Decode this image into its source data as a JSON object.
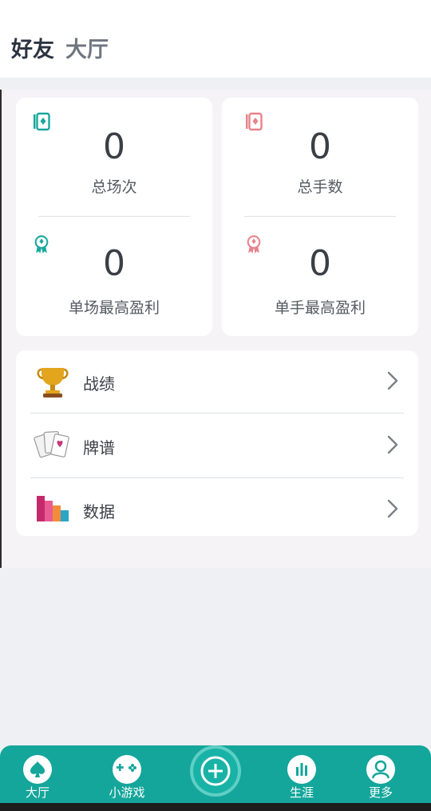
{
  "header": {
    "tab_friends": "好友",
    "tab_lobby": "大厅"
  },
  "stats": {
    "total_games_value": "0",
    "total_games_label": "总场次",
    "total_hands_value": "0",
    "total_hands_label": "总手数",
    "best_game_profit_value": "0",
    "best_game_profit_label": "单场最高盈利",
    "best_hand_profit_value": "0",
    "best_hand_profit_label": "单手最高盈利"
  },
  "menu": {
    "items": [
      {
        "label": "战绩",
        "icon": "trophy-icon"
      },
      {
        "label": "牌谱",
        "icon": "cards-icon"
      },
      {
        "label": "数据",
        "icon": "bar-chart-icon"
      }
    ]
  },
  "nav": {
    "items": [
      {
        "label": "大厅",
        "icon": "spade-icon"
      },
      {
        "label": "小游戏",
        "icon": "gamepad-icon"
      },
      {
        "label": "",
        "icon": "plus-icon"
      },
      {
        "label": "生涯",
        "icon": "stats-icon"
      },
      {
        "label": "更多",
        "icon": "user-icon"
      }
    ]
  },
  "colors": {
    "accent": "#14a69b",
    "teal_icon": "#1aa79c",
    "pink_icon": "#e8838b"
  }
}
